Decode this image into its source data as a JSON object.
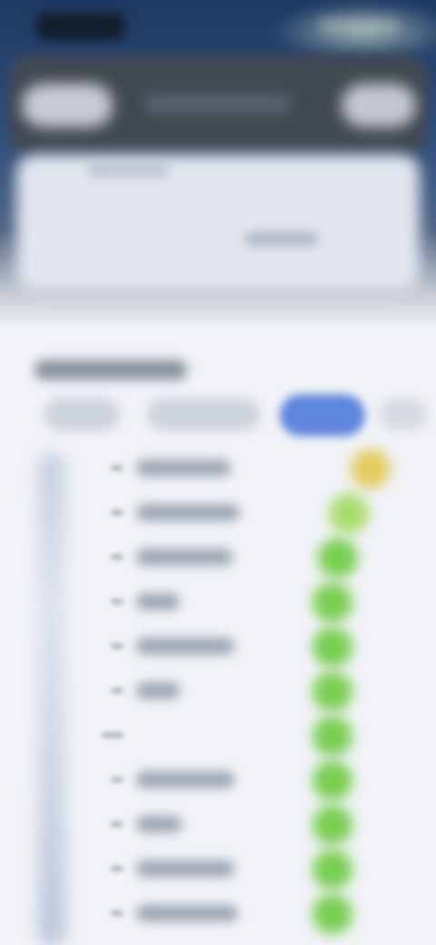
{
  "status_bar": {
    "time": "",
    "icons": [
      "signal-icon",
      "wifi-icon",
      "battery-icon"
    ]
  },
  "toolbar": {
    "left_button": "",
    "title": "",
    "right_button": ""
  },
  "hero_card": {
    "title": "",
    "subtitle": ""
  },
  "section": {
    "title": ""
  },
  "tabs": [
    {
      "label": ""
    },
    {
      "label": ""
    },
    {
      "label": "",
      "selected": true
    },
    {
      "label": ""
    }
  ],
  "list": {
    "rows": [
      {
        "label": "",
        "score_color": "#e4cc62"
      },
      {
        "label": "",
        "score_color": "#a8dd6c"
      },
      {
        "label": "",
        "score_color": "#79cf52"
      },
      {
        "label": "",
        "score_color": "#79cf52"
      },
      {
        "label": "",
        "score_color": "#79cf52"
      },
      {
        "label": "",
        "score_color": "#79cf52"
      },
      {
        "label": "",
        "score_color": "#79cf52"
      },
      {
        "label": "",
        "score_color": "#79cf52"
      },
      {
        "label": "",
        "score_color": "#79cf52"
      },
      {
        "label": "",
        "score_color": "#79cf52"
      },
      {
        "label": "",
        "score_color": "#79cf52"
      }
    ]
  },
  "colors": {
    "accent": "#5d86dc",
    "score_high": "#79cf52",
    "score_mid": "#a8dd6c",
    "score_low": "#e4cc62"
  }
}
